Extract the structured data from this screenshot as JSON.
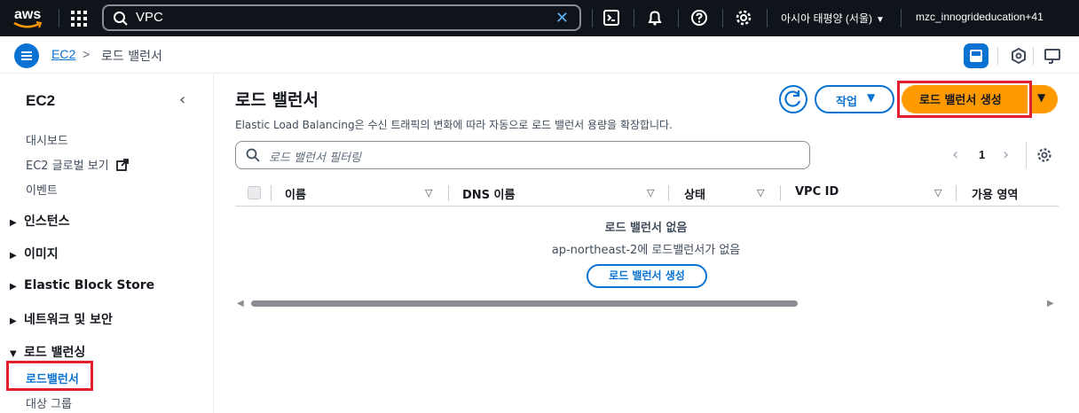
{
  "topnav": {
    "logo_text": "aws",
    "search_value": "VPC",
    "region_label": "아시아 태평양 (서울)",
    "account_label": "mzc_innogrideducation+41"
  },
  "breadcrumb": {
    "root": "EC2",
    "separator": ">",
    "current": "로드 밸런서"
  },
  "sidebar": {
    "title": "EC2",
    "links": [
      "대시보드",
      "EC2 글로벌 보기",
      "이벤트"
    ],
    "sections": [
      "인스턴스",
      "이미지",
      "Elastic Block Store",
      "네트워크 및 보안",
      "로드 밸런싱"
    ],
    "active_item": "로드밸런서",
    "sub_item": "대상 그룹"
  },
  "main": {
    "title": "로드 밸런서",
    "description": "Elastic Load Balancing은 수신 트래픽의 변화에 따라 자동으로 로드 밸런서 용량을 확장합니다.",
    "action_button": "작업",
    "create_button": "로드 밸런서 생성",
    "filter_placeholder": "로드 밸런서 필터링",
    "page_number": "1",
    "columns": [
      "이름",
      "DNS 이름",
      "상태",
      "VPC ID",
      "가용 영역"
    ],
    "empty_title": "로드 밸런서 없음",
    "empty_desc": "ap-northeast-2에 로드밸런서가 없음",
    "empty_button": "로드 밸런서 생성"
  },
  "colors": {
    "nav_bg": "#0f141a",
    "link_blue": "#0972d3",
    "primary_orange": "#ff9900",
    "highlight_red": "#e0202d"
  },
  "icons": [
    "grid-icon",
    "search-icon",
    "clear-icon",
    "cloudshell-icon",
    "bell-icon",
    "help-icon",
    "gear-icon",
    "menu-icon",
    "external-link-icon",
    "refresh-icon",
    "settings-icon"
  ]
}
